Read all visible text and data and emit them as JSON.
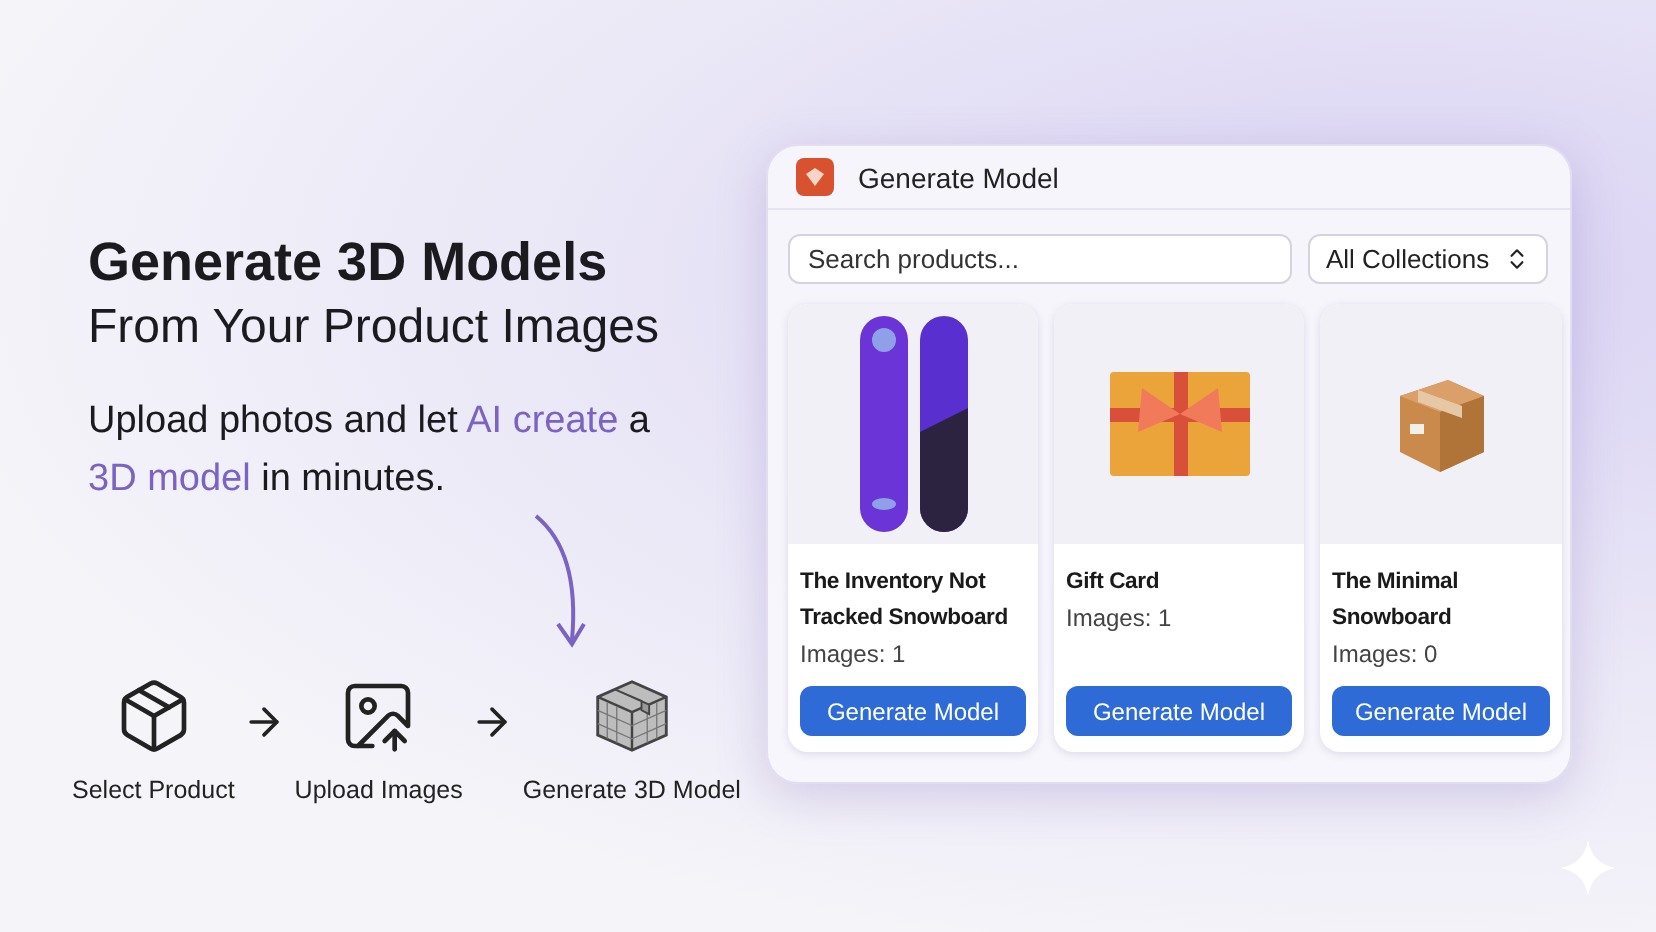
{
  "hero": {
    "headline": "Generate 3D Models",
    "subheadline": "From Your Product Images",
    "tagline": [
      {
        "text": "Upload photos and let ",
        "highlight": false
      },
      {
        "text": "AI create",
        "highlight": true
      },
      {
        "text": " a ",
        "highlight": false
      },
      {
        "text": "3D model",
        "highlight": true
      },
      {
        "text": " in minutes.",
        "highlight": false
      }
    ]
  },
  "steps": [
    {
      "kind": "box",
      "label": "Select Product"
    },
    {
      "kind": "upload",
      "label": "Upload Images"
    },
    {
      "kind": "mesh",
      "label": "Generate 3D Model"
    }
  ],
  "window": {
    "title": "Generate Model",
    "search": {
      "placeholder": "Search products..."
    },
    "collection": {
      "value": "All Collections"
    },
    "products": [
      {
        "kind": "snowboard",
        "name": "The Inventory Not Tracked Snowboard",
        "images": "Images: 1",
        "button": "Generate Model"
      },
      {
        "kind": "gift",
        "name": "Gift Card",
        "images": "Images: 1",
        "button": "Generate Model"
      },
      {
        "kind": "parcel",
        "name": "The Minimal Snowboard",
        "images": "Images: 0",
        "button": "Generate Model"
      }
    ]
  }
}
